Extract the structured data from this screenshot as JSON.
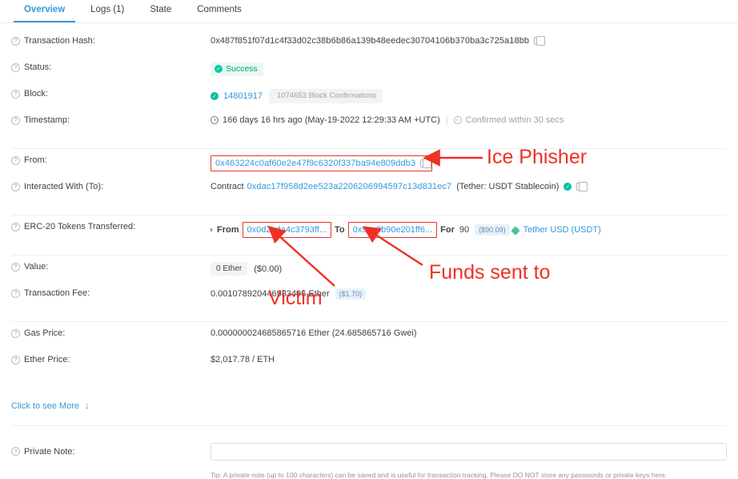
{
  "tabs": [
    {
      "label": "Overview",
      "active": true
    },
    {
      "label": "Logs (1)",
      "active": false
    },
    {
      "label": "State",
      "active": false
    },
    {
      "label": "Comments",
      "active": false
    }
  ],
  "rows": {
    "tx_hash": {
      "label": "Transaction Hash:",
      "value": "0x487f851f07d1c4f33d02c38b6b86a139b48eedec30704106b370ba3c725a18bb"
    },
    "status": {
      "label": "Status:",
      "value": "Success"
    },
    "block": {
      "label": "Block:",
      "number": "14801917",
      "confirmations": "1074653 Block Confirmations"
    },
    "timestamp": {
      "label": "Timestamp:",
      "ago": "166 days 16 hrs ago (May-19-2022 12:29:33 AM +UTC)",
      "confirmed": "Confirmed within 30 secs"
    },
    "from": {
      "label": "From:",
      "address": "0x463224c0af60e2e47f9c6320f337ba94e809ddb3"
    },
    "to": {
      "label": "Interacted With (To):",
      "prefix": "Contract",
      "address": "0xdac17f958d2ee523a2206206994597c13d831ec7",
      "tag": "(Tether: USDT Stablecoin)"
    },
    "erc20": {
      "label": "ERC-20 Tokens Transferred:",
      "from_word": "From",
      "from_address": "0x0d2eda4c3793ff...",
      "to_word": "To",
      "to_address": "0x9ca3b90e201ff6...",
      "for_word": "For",
      "amount": "90",
      "usd": "($90.09)",
      "token": "Tether USD (USDT)"
    },
    "value": {
      "label": "Value:",
      "amount": "0 Ether",
      "usd": "($0.00)"
    },
    "txfee": {
      "label": "Transaction Fee:",
      "amount": "0.001078920446983496 Ether",
      "usd": "($1.70)"
    },
    "gasprice": {
      "label": "Gas Price:",
      "value": "0.000000024685865716 Ether (24.685865716 Gwei)"
    },
    "etherprice": {
      "label": "Ether Price:",
      "value": "$2,017.78 / ETH"
    },
    "private_note": {
      "label": "Private Note:",
      "input_value": "",
      "tip": "Tip: A private note (up to 100 characters) can be saved and is useful for transaction tracking. Please DO NOT store any passwords or private keys here."
    }
  },
  "see_more": {
    "label": "Click to see More",
    "arrow": "↓"
  },
  "annotations": [
    {
      "id": "ice-phisher",
      "text": "Ice Phisher"
    },
    {
      "id": "funds-sent-to",
      "text": "Funds sent to"
    },
    {
      "id": "victim",
      "text": "Victim"
    }
  ],
  "colors": {
    "accent_blue": "#3498db",
    "success_green": "#00a186",
    "annotation_red": "#ee3124",
    "muted_grey": "#9aa3ab"
  }
}
